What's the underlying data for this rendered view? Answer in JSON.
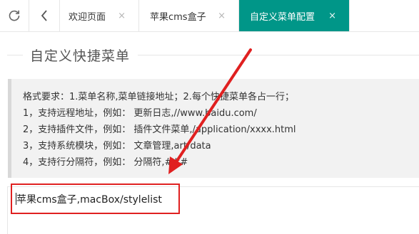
{
  "tabbar": {
    "tabs": [
      {
        "label": "欢迎页面",
        "close": "×"
      },
      {
        "label": "苹果cms盒子",
        "close": "×"
      },
      {
        "label": "自定义菜单配置",
        "close": "×",
        "active": true
      }
    ]
  },
  "section": {
    "title": "自定义快捷菜单"
  },
  "info": {
    "lines": [
      "格式要求：1.菜单名称,菜单链接地址；2.每个快捷菜单各占一行；",
      "1，支持远程地址，例如： 更新日志,//www.baidu.com/",
      "2，支持插件文件，例如： 插件文件菜单,/application/xxxx.html",
      "3，支持系统模块，例如： 文章管理,art/data",
      "4，支持行分隔符，例如： 分隔符,###"
    ]
  },
  "editor": {
    "value": "苹果cms盒子,macBox/stylelist"
  },
  "colors": {
    "active_tab": "#009688",
    "annotation": "#e02020",
    "info_bg": "#f2f2f2"
  },
  "icons": {
    "refresh": "refresh-icon",
    "back": "chevron-left-icon",
    "close": "close-icon"
  }
}
